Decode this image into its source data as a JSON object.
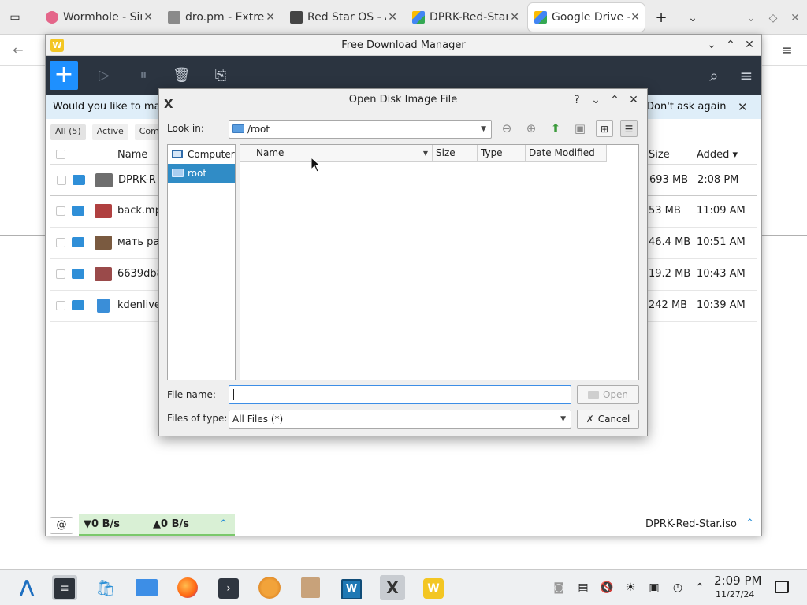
{
  "browser": {
    "tabs": [
      {
        "title": "Wormhole - Sim",
        "favicon_color": "#e4668a"
      },
      {
        "title": "dro.pm - Extrem",
        "favicon_color": "#8a8a8a"
      },
      {
        "title": "Red Star OS - A",
        "favicon_color": "#444444"
      },
      {
        "title": "DPRK-Red-Star",
        "favicon_color": "#4285f4"
      },
      {
        "title": "Google Drive -",
        "favicon_color": "#34a853"
      }
    ]
  },
  "fdm": {
    "title": "Free Download Manager",
    "banner_text": "Would you like to make",
    "banner_dont_ask": "Don't ask again",
    "filters": [
      "All (5)",
      "Active",
      "Com"
    ],
    "columns": {
      "name": "Name",
      "size": "Size",
      "added": "Added"
    },
    "rows": [
      {
        "name": "DPRK-R",
        "size": "693 MB",
        "added": "2:08 PM",
        "thumb": "#6e6e6e"
      },
      {
        "name": "back.mp",
        "size": "53 MB",
        "added": "11:09 AM",
        "thumb": "#b04040"
      },
      {
        "name": "мать ра",
        "size": "46.4 MB",
        "added": "10:51 AM",
        "thumb": "#7a5a40"
      },
      {
        "name": "6639db8",
        "size": "19.2 MB",
        "added": "10:43 AM",
        "thumb": "#9a4a4a"
      },
      {
        "name": "kdenlive",
        "size": "242 MB",
        "added": "10:39 AM",
        "thumb": "#3a8ed8"
      }
    ],
    "status": {
      "down": "▼0 B/s",
      "up": "▲0 B/s",
      "filename": "DPRK-Red-Star.iso"
    }
  },
  "dialog": {
    "title": "Open Disk Image File",
    "look_in_label": "Look in:",
    "look_in_value": "/root",
    "sidebar": [
      "Computer",
      "root"
    ],
    "file_columns": [
      "Name",
      "Size",
      "Type",
      "Date Modified"
    ],
    "file_name_label": "File name:",
    "file_name_value": "",
    "files_of_type_label": "Files of type:",
    "files_of_type_value": "All Files (*)",
    "open_label": "Open",
    "cancel_label": "Cancel"
  },
  "taskbar": {
    "time": "2:09 PM",
    "date": "11/27/24"
  },
  "colors": {
    "accent": "#1e90ff",
    "toolbar_bg": "#2b3440",
    "selection": "#308cc6",
    "speed_bg": "#d9f0d5"
  }
}
